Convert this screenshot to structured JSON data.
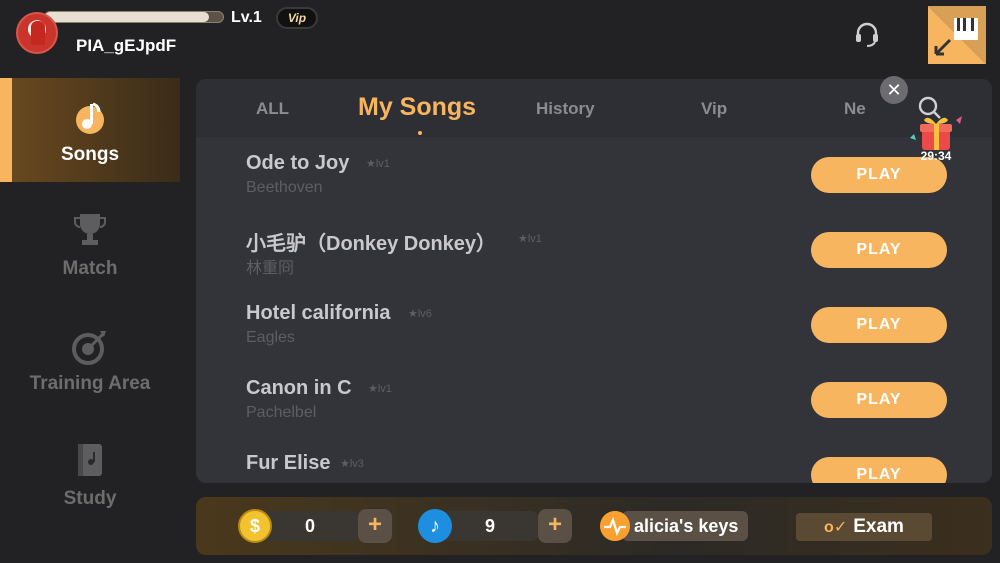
{
  "profile": {
    "username": "PIA_gEJpdF",
    "level": "Lv.1",
    "vip_badge": "Vip",
    "xp_progress": 0.92
  },
  "sidebar": {
    "items": [
      {
        "label": "Songs",
        "icon": "music-note-icon",
        "active": true
      },
      {
        "label": "Match",
        "icon": "trophy-icon",
        "active": false
      },
      {
        "label": "Training Area",
        "icon": "target-icon",
        "active": false
      },
      {
        "label": "Study",
        "icon": "book-icon",
        "active": false
      }
    ]
  },
  "tabs": [
    {
      "label": "ALL"
    },
    {
      "label": "My Songs",
      "active": true
    },
    {
      "label": "History"
    },
    {
      "label": "Vip"
    },
    {
      "label": "Ne"
    }
  ],
  "songs": [
    {
      "title": "Ode to Joy",
      "level": "★lv1",
      "artist": "Beethoven",
      "button": "PLAY"
    },
    {
      "title": "小毛驴（Donkey Donkey）",
      "level": "★lv1",
      "artist": "林重冏",
      "button": "PLAY"
    },
    {
      "title": "Hotel california",
      "level": "★lv6",
      "artist": "Eagles",
      "button": "PLAY"
    },
    {
      "title": "Canon in C",
      "level": "★lv1",
      "artist": "Pachelbel",
      "button": "PLAY"
    },
    {
      "title": "Fur Elise",
      "level": "★lv3",
      "artist": "",
      "button": "PLAY"
    }
  ],
  "gift": {
    "timer": "29:34"
  },
  "close_label": "✕",
  "bottombar": {
    "coins": "0",
    "notes": "9",
    "plus_label": "+",
    "keys_label": "alicia's keys",
    "exam_label": "Exam",
    "exam_icon": "o✓"
  },
  "colors": {
    "accent": "#f8b560",
    "background": "#222224",
    "panel": "#33343a"
  }
}
